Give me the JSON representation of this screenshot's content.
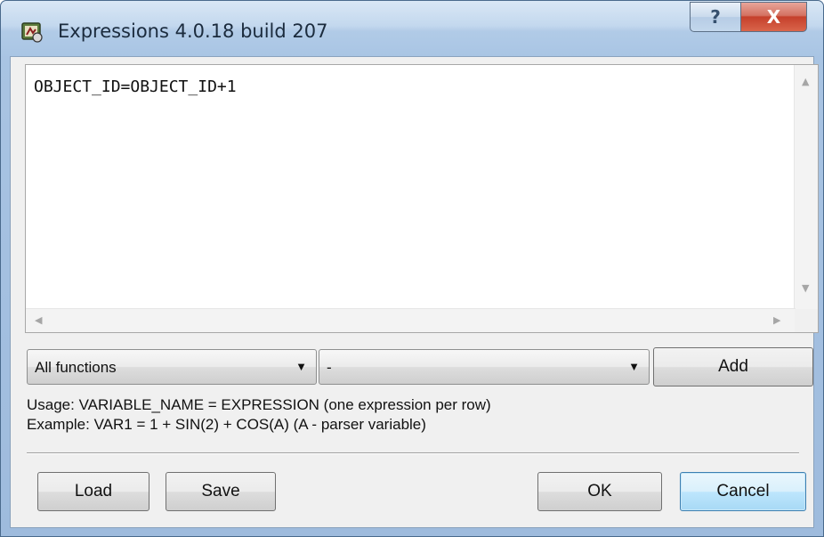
{
  "window": {
    "title": "Expressions 4.0.18 build 207",
    "help_label": "?",
    "close_label": "X"
  },
  "editor": {
    "text": "OBJECT_ID=OBJECT_ID+1"
  },
  "controls": {
    "functions_combo": "All functions",
    "function_select": "-",
    "add_label": "Add"
  },
  "help": {
    "usage": "Usage: VARIABLE_NAME = EXPRESSION (one expression per row)",
    "example": "Example: VAR1 = 1 + SIN(2) + COS(A) (A - parser variable)"
  },
  "buttons": {
    "load": "Load",
    "save": "Save",
    "ok": "OK",
    "cancel": "Cancel"
  },
  "icons": {
    "app": "app-icon",
    "scroll_up": "scroll-up-icon",
    "scroll_down": "scroll-down-icon",
    "scroll_left": "scroll-left-icon",
    "scroll_right": "scroll-right-icon",
    "dropdown": "chevron-down-icon"
  }
}
